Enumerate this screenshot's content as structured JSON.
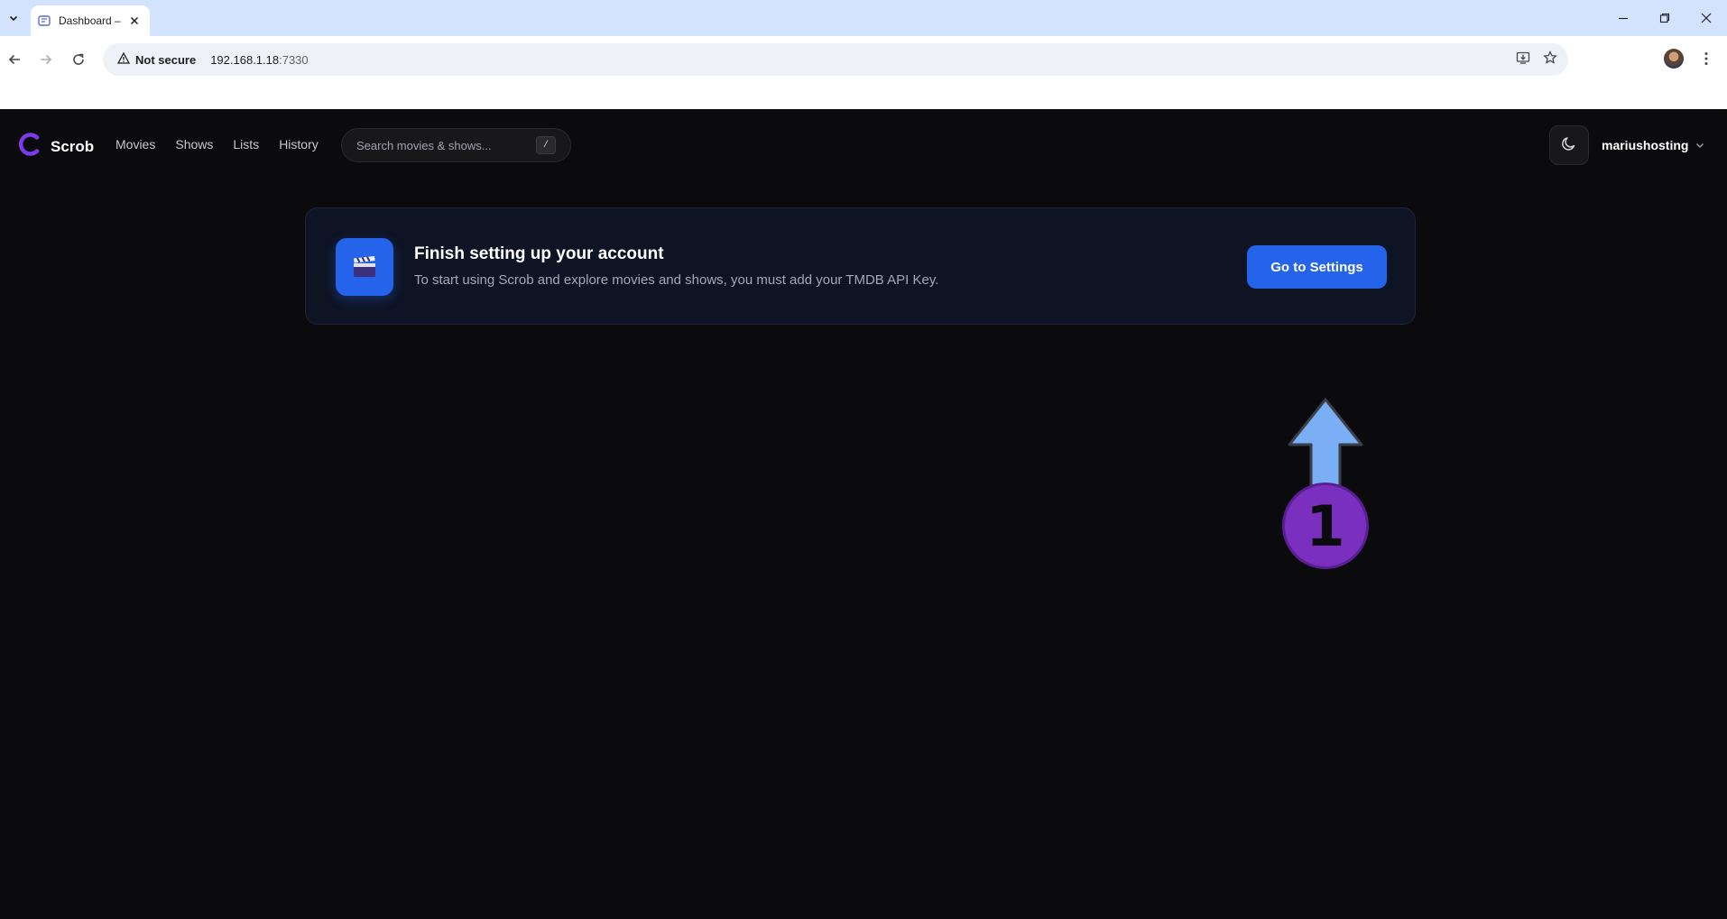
{
  "browser": {
    "tab": {
      "title": "Dashboard – "
    },
    "address_bar": {
      "security_label": "Not secure",
      "host": "192.168.1.18",
      "port": ":7330"
    }
  },
  "app": {
    "brand": {
      "name": "Scrob",
      "accent": "#7c3aed"
    },
    "nav": [
      {
        "label": "Movies"
      },
      {
        "label": "Shows"
      },
      {
        "label": "Lists"
      },
      {
        "label": "History"
      }
    ],
    "search": {
      "placeholder": "Search movies & shows...",
      "shortcut": "/"
    },
    "user": {
      "name": "mariushosting"
    }
  },
  "banner": {
    "icon": "clapperboard-icon",
    "title": "Finish setting up your account",
    "description": "To start using Scrob and explore movies and shows, you must add your TMDB API Key.",
    "button_label": "Go to Settings",
    "button_color": "#2563eb"
  },
  "annotation": {
    "step": "1",
    "color": "#7b2fbf",
    "arrow_color": "#7aaef5"
  }
}
